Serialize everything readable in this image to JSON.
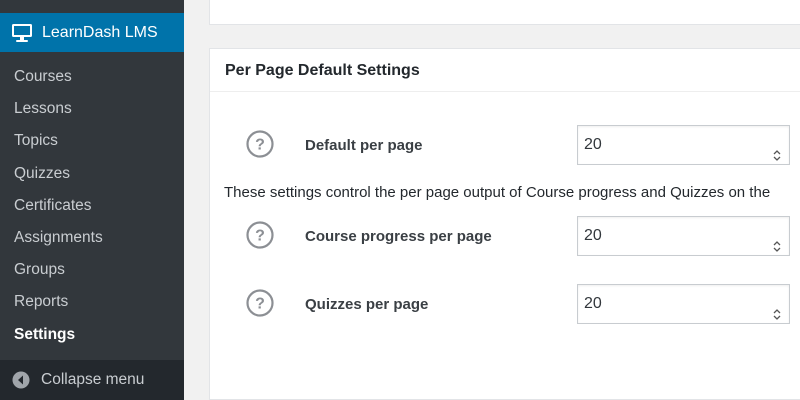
{
  "sidebar": {
    "main_item": {
      "label": "LearnDash LMS",
      "icon": "monitor-icon"
    },
    "items": [
      {
        "label": "Courses"
      },
      {
        "label": "Lessons"
      },
      {
        "label": "Topics"
      },
      {
        "label": "Quizzes"
      },
      {
        "label": "Certificates"
      },
      {
        "label": "Assignments"
      },
      {
        "label": "Groups"
      },
      {
        "label": "Reports"
      },
      {
        "label": "Settings",
        "current": true
      }
    ],
    "collapse": {
      "label": "Collapse menu",
      "icon": "collapse-arrow-icon"
    }
  },
  "panel": {
    "title": "Per Page Default Settings",
    "rows": [
      {
        "label": "Default per page",
        "value": "20",
        "icon": "help-icon"
      },
      {
        "label": "Course progress per page",
        "value": "20",
        "icon": "help-icon"
      },
      {
        "label": "Quizzes per page",
        "value": "20",
        "icon": "help-icon"
      }
    ],
    "note": "These settings control the per page output of Course progress and Quizzes on the"
  },
  "colors": {
    "sidebar_bg": "#23282d",
    "submenu_bg": "#32373c",
    "accent": "#0073aa",
    "page_bg": "#f1f1f1"
  }
}
